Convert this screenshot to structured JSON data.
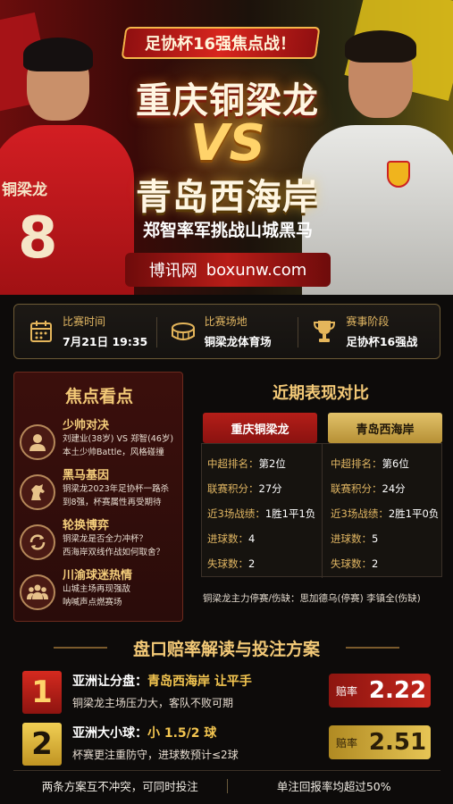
{
  "hero": {
    "promo_tag": "足协杯16强焦点战！",
    "team_a": "重庆铜梁龙",
    "vs": "VS",
    "team_b": "青岛西海岸",
    "subtitle": "郑智率军挑战山城黑马",
    "site_cn": "博讯网",
    "site_en": "boxunw.com",
    "left_shirt_name": "铜梁龙",
    "left_shirt_number": "8"
  },
  "info": [
    {
      "label": "比赛时间",
      "value": "7月21日 19:35",
      "icon": "calendar-icon"
    },
    {
      "label": "比赛场地",
      "value": "铜梁龙体育场",
      "icon": "stadium-icon"
    },
    {
      "label": "赛事阶段",
      "value": "足协杯16强战",
      "icon": "trophy-icon"
    }
  ],
  "focus": {
    "title": "焦点看点",
    "items": [
      {
        "title": "少帅对决",
        "line1": "刘建业(38岁) VS 郑智(46岁)",
        "line2": "本土少帅Battle，风格碰撞",
        "icon": "coach-icon"
      },
      {
        "title": "黑马基因",
        "line1": "铜梁龙2023年足协杯一路杀",
        "line2": "到8强，杯赛属性再受期待",
        "icon": "horse-icon"
      },
      {
        "title": "轮换博弈",
        "line1": "铜梁龙是否全力冲杯？",
        "line2": "西海岸双线作战如何取舍？",
        "icon": "rotate-icon"
      },
      {
        "title": "川渝球迷热情",
        "line1": "山城主场再现强敌",
        "line2": "呐喊声点燃赛场",
        "icon": "fans-icon"
      }
    ]
  },
  "recent": {
    "title": "近期表现对比",
    "team_a": "重庆铜梁龙",
    "team_b": "青岛西海岸",
    "labels": [
      "中超排名：",
      "联赛积分：",
      "近3场战绩：",
      "进球数：",
      "失球数："
    ],
    "a_values": [
      "第2位",
      "27分",
      "1胜1平1负",
      "4",
      "2"
    ],
    "b_values": [
      "第6位",
      "24分",
      "2胜1平0负",
      "5",
      "2"
    ],
    "absence": "铜梁龙主力停赛/伤缺：思加德乌(停赛) 李镇全(伤缺)"
  },
  "odds": {
    "title": "盘口赔率解读与投注方案",
    "plans": [
      {
        "num": "1",
        "main_prefix": "亚洲让分盘：",
        "main_pick": "青岛西海岸 让平手",
        "desc": "铜梁龙主场压力大，客队不败可期",
        "odd_label": "赔率",
        "odd_value": "2.22"
      },
      {
        "num": "2",
        "main_prefix": "亚洲大小球：",
        "main_pick": "小 1.5/2 球",
        "desc": "杯赛更注重防守，进球数预计≤2球",
        "odd_label": "赔率",
        "odd_value": "2.51"
      }
    ]
  },
  "footer": {
    "left": "两条方案互不冲突，可同时投注",
    "right": "单注回报率均超过50%"
  },
  "colors": {
    "accent_gold": "#f3c977",
    "team_a_red": "#b41e18",
    "team_b_gold": "#e2c26a"
  }
}
